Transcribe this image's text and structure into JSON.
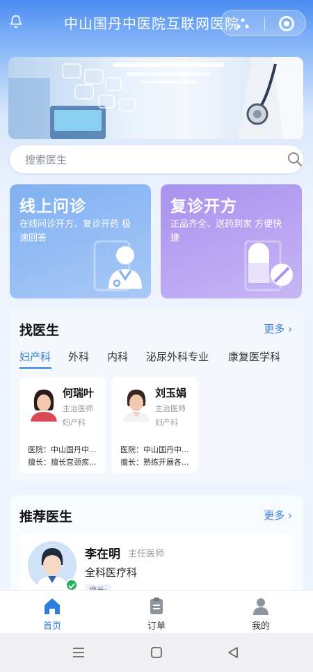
{
  "header": {
    "title": "中山国丹中医院互联网医院",
    "bell_icon": "bell-icon",
    "more_icon": "more-dots-icon",
    "close_icon": "target-icon"
  },
  "banner": {
    "alt_icon": "doctor-banner-image"
  },
  "search": {
    "placeholder": "搜索医生",
    "icon": "search-icon"
  },
  "services": [
    {
      "title": "线上问诊",
      "subtitle": "在线问诊开方、复诊开药 极速回答",
      "icon": "doctor-icon"
    },
    {
      "title": "复诊开方",
      "subtitle": "正品齐全、送药到家 方便快捷",
      "icon": "pill-icon"
    }
  ],
  "find_doctor": {
    "title": "找医生",
    "more": "更多",
    "tabs": [
      "妇产科",
      "外科",
      "内科",
      "泌尿外科专业",
      "康复医学科"
    ],
    "active_tab": 0,
    "doctors": [
      {
        "name": "何瑞叶",
        "title": "主治医师",
        "dept": "妇产科",
        "hospital": "医院：中山国丹中...",
        "skill": "擅长：擅长宫颈疾..."
      },
      {
        "name": "刘玉娟",
        "title": "主治医师",
        "dept": "妇产科",
        "hospital": "医院：中山国丹中...",
        "skill": "擅长：熟练开展各..."
      }
    ]
  },
  "recommend": {
    "title": "推荐医生",
    "more": "更多",
    "doctor": {
      "name": "李在明",
      "title": "主任医师",
      "dept": "全科医疗科",
      "tag": "擅长:"
    }
  },
  "tabbar": [
    {
      "label": "首页",
      "icon": "home-icon",
      "active": true
    },
    {
      "label": "订单",
      "icon": "order-icon",
      "active": false
    },
    {
      "label": "我的",
      "icon": "user-icon",
      "active": false
    }
  ],
  "system_nav": [
    "menu-icon",
    "home-square-icon",
    "back-triangle-icon"
  ],
  "colors": {
    "accent": "#2d7de0",
    "card_blue": "#7fb0f2",
    "card_purple": "#a991ef",
    "verified": "#22b35e"
  }
}
